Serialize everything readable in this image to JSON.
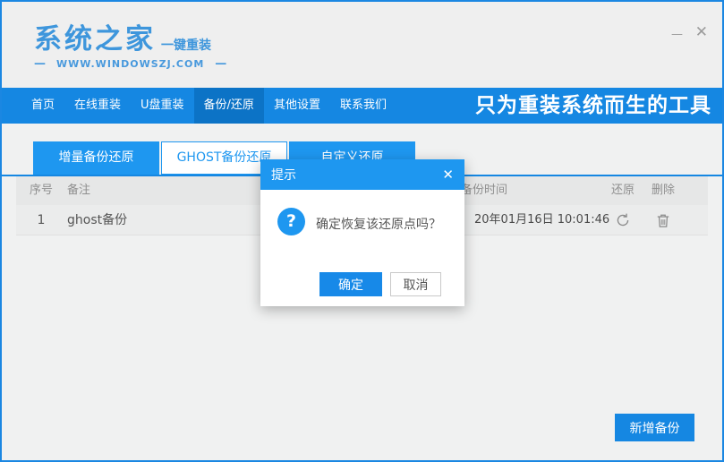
{
  "header": {
    "logo": "系统之家",
    "logo_suffix": "一键重装",
    "dash": "—",
    "website": "WWW.WINDOWSZJ.COM",
    "minimize_glyph": "—",
    "close_glyph": "✕"
  },
  "nav": {
    "items": [
      {
        "label": "首页",
        "active": false
      },
      {
        "label": "在线重装",
        "active": false
      },
      {
        "label": "U盘重装",
        "active": false
      },
      {
        "label": "备份/还原",
        "active": true
      },
      {
        "label": "其他设置",
        "active": false
      },
      {
        "label": "联系我们",
        "active": false
      }
    ],
    "slogan": "只为重装系统而生的工具"
  },
  "tabs": [
    {
      "label": "增量备份还原",
      "selected": false
    },
    {
      "label": "GHOST备份还原",
      "selected": true
    },
    {
      "label": "自定义还原",
      "selected": false
    }
  ],
  "table": {
    "headers": {
      "no": "序号",
      "note": "备注",
      "time": "备份时间",
      "restore": "还原",
      "delete": "删除"
    },
    "rows": [
      {
        "no": "1",
        "note": "ghost备份",
        "time": "20年01月16日 10:01:46"
      }
    ],
    "icons": {
      "restore": "refresh-icon",
      "delete": "trash-icon"
    }
  },
  "footer": {
    "new_backup_label": "新增备份"
  },
  "dialog": {
    "title": "提示",
    "close_glyph": "✕",
    "question_glyph": "?",
    "message": "确定恢复该还原点吗？",
    "ok_label": "确定",
    "cancel_label": "取消"
  },
  "colors": {
    "window_border": "#1b87e2",
    "nav_blue": "#1587e2",
    "nav_active_blue": "#0c73c6",
    "bright_blue": "#1e97f0",
    "logo_blue": "#3e96dc",
    "header_gray": "#efefef",
    "table_header_gray": "#e6e7e7",
    "row_gray": "#ebecec"
  }
}
